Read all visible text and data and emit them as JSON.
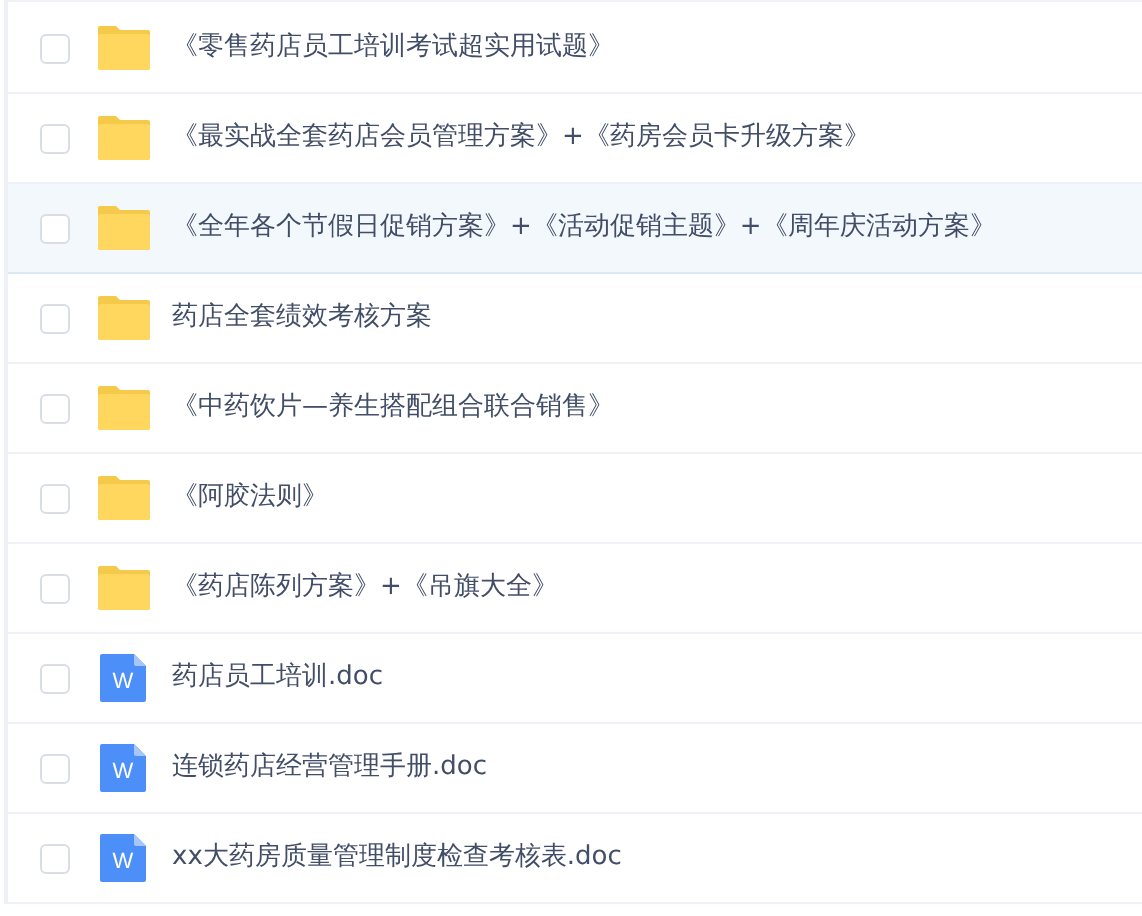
{
  "files": [
    {
      "kind": "folder",
      "name": "《零售药店员工培训考试超实用试题》",
      "checked": false,
      "highlighted": false
    },
    {
      "kind": "folder",
      "name": "《最实战全套药店会员管理方案》+《药房会员卡升级方案》",
      "checked": false,
      "highlighted": false
    },
    {
      "kind": "folder",
      "name": "《全年各个节假日促销方案》+《活动促销主题》+《周年庆活动方案》",
      "checked": false,
      "highlighted": true
    },
    {
      "kind": "folder",
      "name": "药店全套绩效考核方案",
      "checked": false,
      "highlighted": false
    },
    {
      "kind": "folder",
      "name": "《中药饮片—养生搭配组合联合销售》",
      "checked": false,
      "highlighted": false
    },
    {
      "kind": "folder",
      "name": "《阿胶法则》",
      "checked": false,
      "highlighted": false
    },
    {
      "kind": "folder",
      "name": "《药店陈列方案》+《吊旗大全》",
      "checked": false,
      "highlighted": false
    },
    {
      "kind": "doc",
      "icon_letter": "W",
      "name": "药店员工培训.doc",
      "checked": false,
      "highlighted": false
    },
    {
      "kind": "doc",
      "icon_letter": "W",
      "name": "连锁药店经营管理手册.doc",
      "checked": false,
      "highlighted": false
    },
    {
      "kind": "doc",
      "icon_letter": "W",
      "name": "xx大药房质量管理制度检查考核表.doc",
      "checked": false,
      "highlighted": false
    }
  ]
}
